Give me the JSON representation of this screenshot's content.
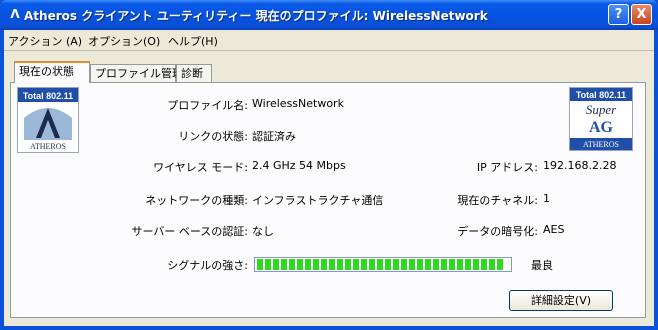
{
  "window": {
    "title": "Atheros クライアント ユーティリティー 現在のプロファイル: WirelessNetwork",
    "help_button": "?",
    "close_button": "X"
  },
  "menu": {
    "items": [
      {
        "label": "アクション (A)"
      },
      {
        "label": "オプション(O)"
      },
      {
        "label": "ヘルプ(H)"
      }
    ]
  },
  "tabs": [
    {
      "label": "現在の状態",
      "active": true
    },
    {
      "label": "プロファイル管理",
      "active": false
    },
    {
      "label": "診断",
      "active": false
    }
  ],
  "logos": {
    "left": {
      "badge": "Total 802.11",
      "brand": "ATHEROS"
    },
    "right": {
      "badge": "Total 802.11",
      "line1": "Super",
      "line2": "AG",
      "brand": "ATHEROS"
    }
  },
  "status": {
    "profile_name_label": "プロファイル名:",
    "profile_name_value": "WirelessNetwork",
    "link_status_label": "リンクの状態:",
    "link_status_value": "認証済み",
    "wireless_mode_label": "ワイヤレス モード:",
    "wireless_mode_value": "2.4 GHz 54 Mbps",
    "ip_label": "IP アドレス:",
    "ip_value": "192.168.2.28",
    "network_type_label": "ネットワークの種類:",
    "network_type_value": "インフラストラクチャ通信",
    "channel_label": "現在のチャネル:",
    "channel_value": "1",
    "server_auth_label": "サーバー ベースの認証:",
    "server_auth_value": "なし",
    "encryption_label": "データの暗号化:",
    "encryption_value": "AES",
    "signal_label": "シグナルの強さ:",
    "signal_fraction": 1.0,
    "signal_text": "最良",
    "signal_color": "#2fd81f"
  },
  "buttons": {
    "advanced": "詳細設定(V)"
  },
  "colors": {
    "titlebar": "#0553e0",
    "tab_accent": "#e68b2c",
    "logo_blue": "#1f4fa8"
  }
}
